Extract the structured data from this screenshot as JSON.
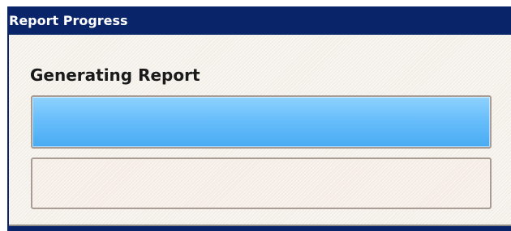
{
  "window": {
    "title": "Report Progress"
  },
  "content": {
    "heading": "Generating Report",
    "progress": {
      "value": 1.0,
      "fill_color": "#5bb6f8"
    },
    "secondary_progress": {
      "value": 0.0
    }
  },
  "colors": {
    "titlebar": "#0a246a",
    "title_text": "#ffffff",
    "client_background": "#f3efe8",
    "bar_border": "#a89c94"
  }
}
